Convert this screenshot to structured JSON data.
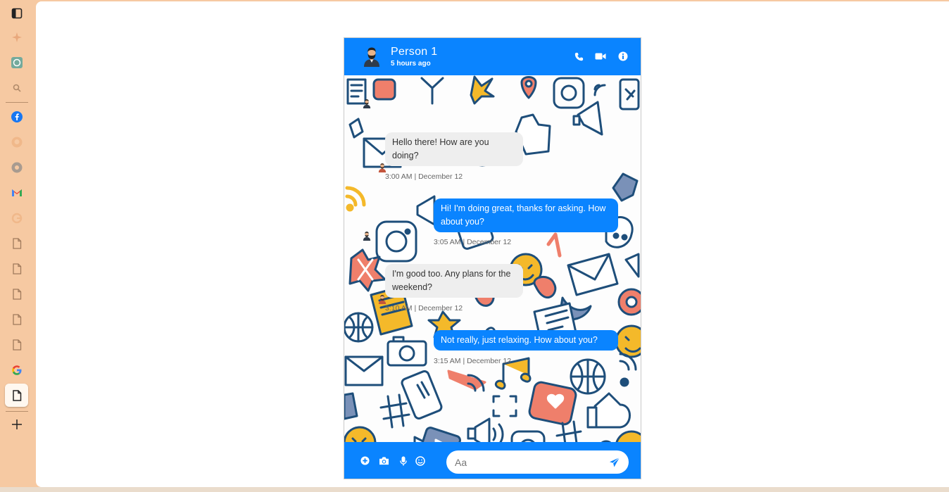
{
  "colors": {
    "accent": "#0a84ff",
    "incoming_bubble": "#eeeeee",
    "sidebar_bg": "#f6c9a2"
  },
  "sidebar": {
    "icons": [
      "sidebar-toggle-icon",
      "sparkle-icon",
      "chatgpt-icon",
      "search-icon",
      "facebook-icon",
      "github-icon",
      "chrome-icon",
      "gmail-icon",
      "google-icon",
      "file-icon",
      "file-icon",
      "file-icon",
      "file-icon",
      "file-icon",
      "google-icon",
      "file-icon",
      "plus-icon"
    ]
  },
  "chat": {
    "header": {
      "name": "Person 1",
      "status": "5 hours ago",
      "actions": [
        "phone-icon",
        "video-icon",
        "info-icon"
      ]
    },
    "messages": [
      {
        "direction": "incoming",
        "text": "Hello there! How are you doing?",
        "time": "3:00 AM | December 12"
      },
      {
        "direction": "outgoing",
        "text": "Hi! I'm doing great, thanks for asking. How about you?",
        "time": "3:05 AM | December 12"
      },
      {
        "direction": "incoming",
        "text": "I'm good too. Any plans for the weekend?",
        "time": "3:10 AM | December 12"
      },
      {
        "direction": "outgoing",
        "text": "Not really, just relaxing. How about you?",
        "time": "3:15 AM | December 12"
      }
    ],
    "footer": {
      "actions": [
        "plus-circle-icon",
        "camera-icon",
        "microphone-icon",
        "emoji-icon"
      ],
      "input_placeholder": "Aa",
      "input_value": "",
      "send": "send-icon"
    }
  }
}
